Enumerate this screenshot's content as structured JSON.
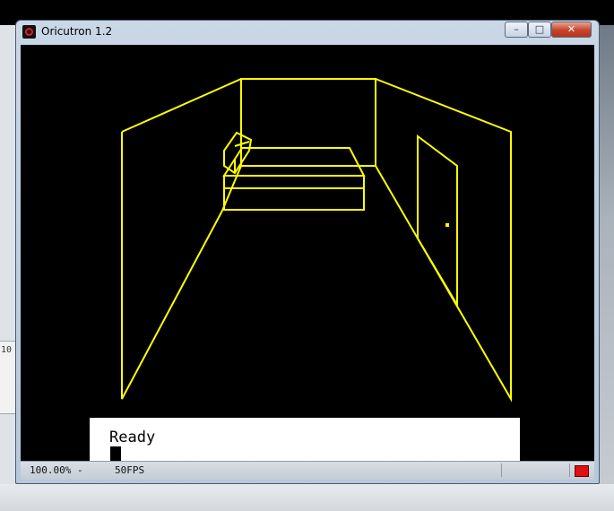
{
  "window": {
    "title": "Oricutron 1.2",
    "minimize_glyph": "–",
    "maximize_glyph": "□",
    "close_glyph": "✕"
  },
  "console": {
    "text": "Ready"
  },
  "statusbar": {
    "zoom": "100.00% -",
    "fps": "50FPS"
  },
  "background": {
    "left_label": "10"
  },
  "colors": {
    "scene_line": "#ffff00",
    "screen_bg": "#000000",
    "close_button": "#c7432a",
    "disk_led": "#e01010"
  },
  "icons": {
    "app": "oricutron-icon",
    "disk": "disk-activity-icon"
  }
}
